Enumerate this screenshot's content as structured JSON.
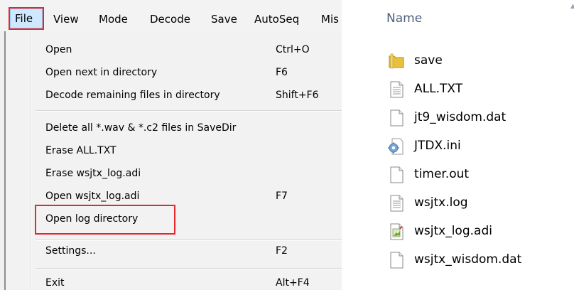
{
  "menubar": {
    "items": [
      "File",
      "View",
      "Mode",
      "Decode",
      "Save",
      "AutoSeq",
      "Mis"
    ]
  },
  "file_menu": {
    "items": [
      {
        "label": "Open",
        "shortcut": "Ctrl+O"
      },
      {
        "label": "Open next in directory",
        "shortcut": "F6"
      },
      {
        "label": "Decode remaining files in directory",
        "shortcut": "Shift+F6"
      },
      {
        "label": "Delete all *.wav & *.c2 files in SaveDir",
        "shortcut": ""
      },
      {
        "label": "Erase ALL.TXT",
        "shortcut": ""
      },
      {
        "label": "Erase wsjtx_log.adi",
        "shortcut": ""
      },
      {
        "label": "Open wsjtx_log.adi",
        "shortcut": "F7"
      },
      {
        "label": "Open log directory",
        "shortcut": ""
      },
      {
        "label": "Settings...",
        "shortcut": "F2"
      },
      {
        "label": "Exit",
        "shortcut": "Alt+F4"
      }
    ]
  },
  "explorer": {
    "column_header": "Name",
    "files": [
      {
        "name": "save",
        "icon": "folder-icon"
      },
      {
        "name": "ALL.TXT",
        "icon": "text-file-icon"
      },
      {
        "name": "jt9_wisdom.dat",
        "icon": "blank-file-icon"
      },
      {
        "name": "JTDX.ini",
        "icon": "settings-file-icon"
      },
      {
        "name": "timer.out",
        "icon": "blank-file-icon"
      },
      {
        "name": "wsjtx.log",
        "icon": "text-file-icon"
      },
      {
        "name": "wsjtx_log.adi",
        "icon": "adi-file-icon"
      },
      {
        "name": "wsjtx_wisdom.dat",
        "icon": "blank-file-icon"
      }
    ]
  },
  "colors": {
    "highlight_red": "#e8262b",
    "folder_yellow": "#e9bf3b",
    "header_text": "#4c607a"
  }
}
